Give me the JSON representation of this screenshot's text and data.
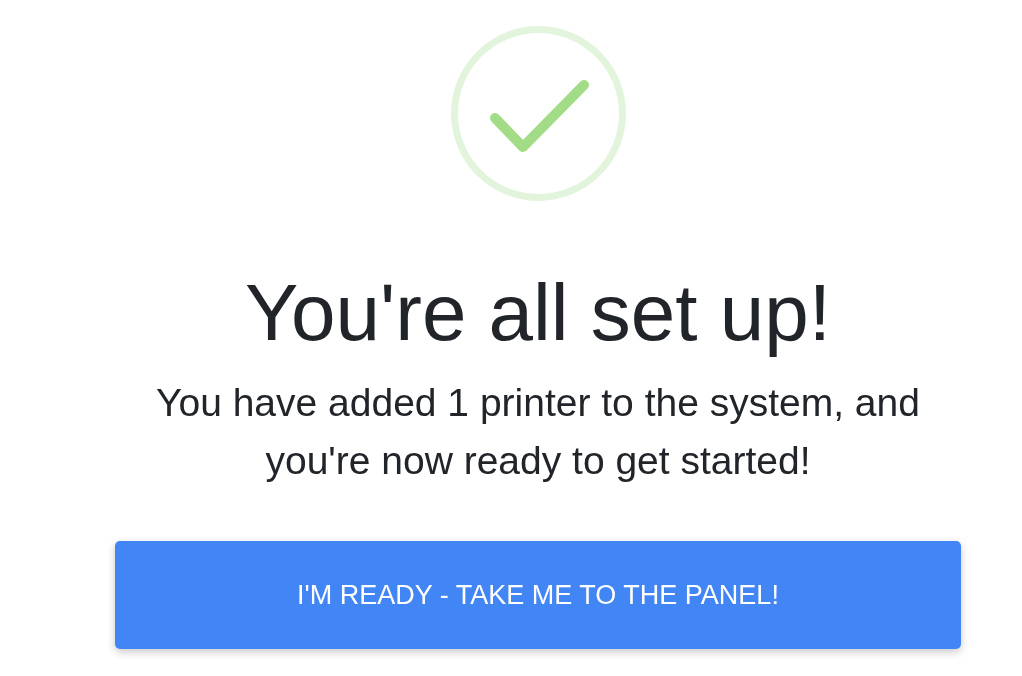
{
  "heading": "You're all set up!",
  "message": "You have added 1 printer to the system, and you're now ready to get started!",
  "button": {
    "label": "I'M READY - TAKE ME TO THE PANEL!"
  }
}
